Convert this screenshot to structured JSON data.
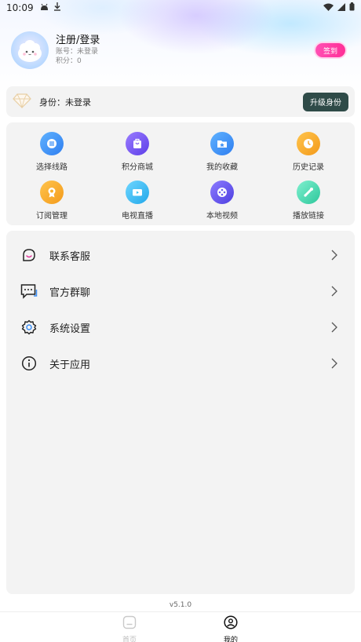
{
  "status_bar": {
    "time": "10:09",
    "icons": [
      "android-icon",
      "download-icon",
      "wifi-icon",
      "signal-icon",
      "battery-icon"
    ]
  },
  "profile": {
    "name": "注册/登录",
    "account": "账号：未登录",
    "points": "积分：0",
    "checkin_label": "签到"
  },
  "identity": {
    "text": "身份：未登录",
    "upgrade_label": "升级身份"
  },
  "grid": {
    "items": [
      {
        "label": "选择线路",
        "icon": "route-icon",
        "color": "#3d8ff5"
      },
      {
        "label": "积分商城",
        "icon": "shop-icon",
        "color": "#7b5cf0"
      },
      {
        "label": "我的收藏",
        "icon": "favorite-folder-icon",
        "color": "#3d8ff5"
      },
      {
        "label": "历史记录",
        "icon": "history-icon",
        "color": "#f7a92b"
      },
      {
        "label": "订阅管理",
        "icon": "subscribe-icon",
        "color": "#f7b02b"
      },
      {
        "label": "电视直播",
        "icon": "tv-icon",
        "color": "#38c0f2"
      },
      {
        "label": "本地视频",
        "icon": "film-reel-icon",
        "color": "#6a5cf0"
      },
      {
        "label": "播放链接",
        "icon": "link-icon",
        "color": "#4fd9b2"
      }
    ]
  },
  "menu": {
    "items": [
      {
        "label": "联系客服",
        "icon": "customer-service-icon"
      },
      {
        "label": "官方群聊",
        "icon": "group-chat-icon"
      },
      {
        "label": "系统设置",
        "icon": "settings-gear-icon"
      },
      {
        "label": "关于应用",
        "icon": "info-icon"
      }
    ]
  },
  "version": "v5.1.0",
  "tabbar": {
    "tabs": [
      {
        "label": "首页",
        "active": false
      },
      {
        "label": "我的",
        "active": true
      }
    ],
    "active_color": "#111111",
    "inactive_color": "#bbbbbb"
  }
}
